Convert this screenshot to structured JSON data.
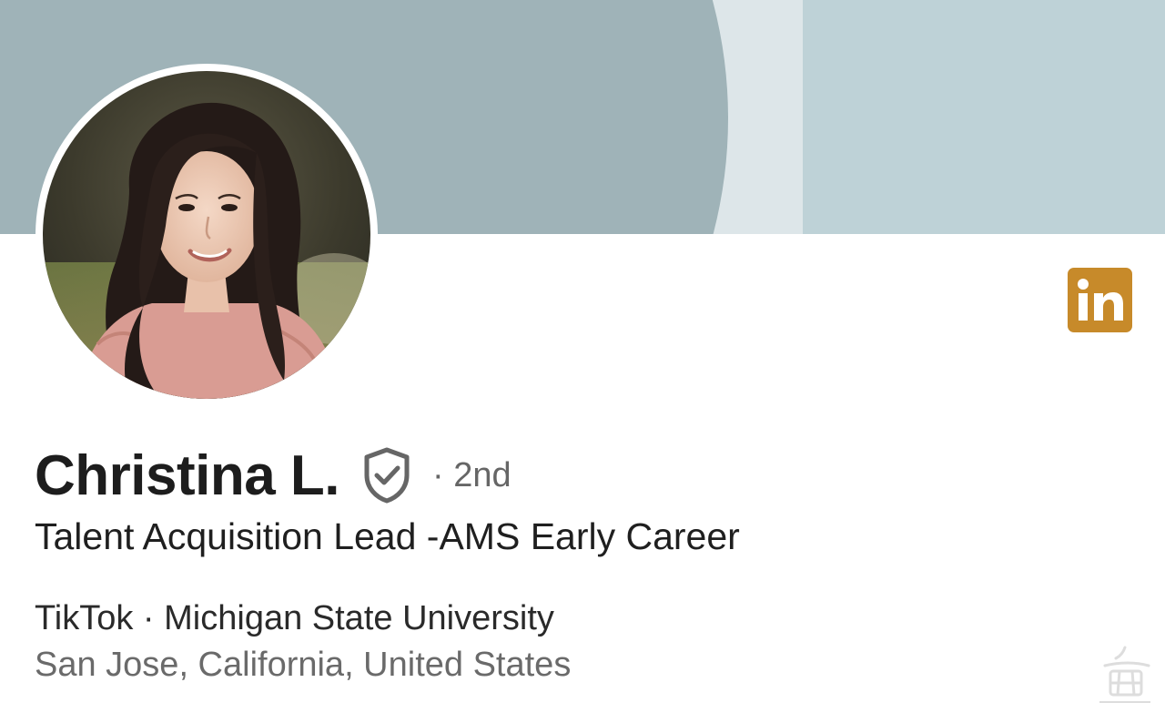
{
  "profile": {
    "name": "Christina L.",
    "degree": "· 2nd",
    "headline": "Talent Acquisition Lead -AMS Early Career",
    "org_line": "TikTok · Michigan State University",
    "location": "San Jose, California, United States"
  },
  "badges": {
    "linkedin_icon": "linkedin-logo-icon",
    "verified_icon": "verified-shield-icon"
  },
  "colors": {
    "banner_dark": "#9fb3b8",
    "banner_light": "#bed2d7",
    "linkedin_badge": "#c78a2a",
    "name_text": "#1d1d1d",
    "secondary_text": "#6a6a6a"
  }
}
